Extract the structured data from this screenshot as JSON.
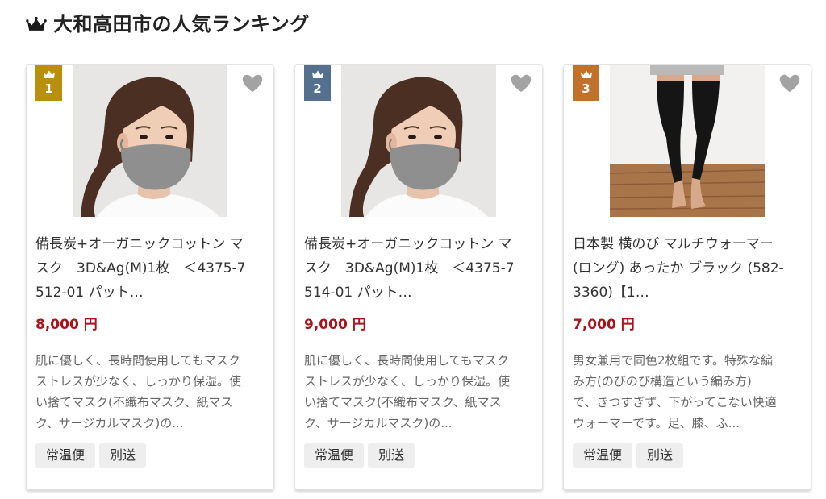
{
  "header": {
    "title": "大和高田市の人気ランキング",
    "icon": "crown-icon"
  },
  "colors": {
    "price": "#a8141b",
    "tag_background": "#eeeeee",
    "favorite_icon": "#a3a3a3"
  },
  "products": [
    {
      "rank": "1",
      "rank_color": "#b8900e",
      "favorite_icon": "heart-icon",
      "title_lines": [
        "備長炭+オーガニックコットン マ",
        "スク　3D&Ag(M)1枚　＜4375-7",
        "512-01 パット…"
      ],
      "price": "8,000 円",
      "description_lines": [
        "肌に優しく、長時間使用してもマスク",
        "ストレスが少なく、しっかり保湿。使",
        "い捨てマスク(不織布マスク、紙マス",
        "ク、サージカルマスク)の..."
      ],
      "tags": [
        "常温便",
        "別送"
      ]
    },
    {
      "rank": "2",
      "rank_color": "#55708f",
      "favorite_icon": "heart-icon",
      "title_lines": [
        "備長炭+オーガニックコットン マ",
        "スク　3D&Ag(M)1枚　＜4375-7",
        "514-01 パット…"
      ],
      "price": "9,000 円",
      "description_lines": [
        "肌に優しく、長時間使用してもマスク",
        "ストレスが少なく、しっかり保湿。使",
        "い捨てマスク(不織布マスク、紙マス",
        "ク、サージカルマスク)の..."
      ],
      "tags": [
        "常温便",
        "別送"
      ]
    },
    {
      "rank": "3",
      "rank_color": "#c0722a",
      "favorite_icon": "heart-icon",
      "title_lines": [
        "日本製 横のび マルチウォーマー",
        "(ロング) あったか ブラック (582-",
        "3360)【1…"
      ],
      "price": "7,000 円",
      "description_lines": [
        "男女兼用で同色2枚組です。特殊な編",
        "み方(のびのび構造という編み方)",
        "で、きつすぎず、下がってこない快適",
        "ウォーマーです。足、膝、ふ..."
      ],
      "tags": [
        "常温便",
        "別送"
      ]
    }
  ]
}
